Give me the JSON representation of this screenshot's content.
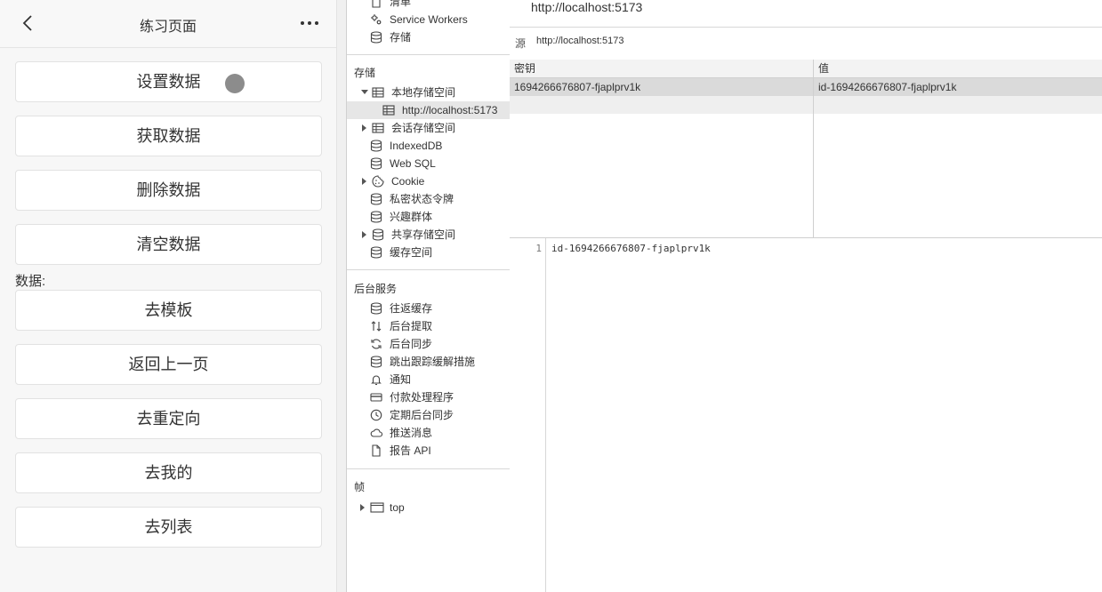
{
  "mobile": {
    "title": "练习页面",
    "buttons": [
      "设置数据",
      "获取数据",
      "删除数据",
      "清空数据"
    ],
    "data_label": "数据:",
    "nav_buttons": [
      "去模板",
      "返回上一页",
      "去重定向",
      "去我的",
      "去列表"
    ]
  },
  "sidebar": {
    "top_items": [
      {
        "label": "清单",
        "icon": "file-icon"
      },
      {
        "label": "Service Workers",
        "icon": "gears-icon"
      },
      {
        "label": "存储",
        "icon": "database-icon"
      }
    ],
    "storage_section": "存储",
    "storage_items": [
      {
        "label": "本地存储空间",
        "icon": "table-icon",
        "arrow": "down"
      },
      {
        "label": "http://localhost:5173",
        "icon": "table-icon",
        "arrow": "",
        "selected": true
      },
      {
        "label": "会话存储空间",
        "icon": "table-icon",
        "arrow": "right"
      },
      {
        "label": "IndexedDB",
        "icon": "database-icon",
        "arrow": ""
      },
      {
        "label": "Web SQL",
        "icon": "database-icon",
        "arrow": ""
      },
      {
        "label": "Cookie",
        "icon": "cookie-icon",
        "arrow": "right"
      },
      {
        "label": "私密状态令牌",
        "icon": "database-icon",
        "arrow": ""
      },
      {
        "label": "兴趣群体",
        "icon": "database-icon",
        "arrow": ""
      },
      {
        "label": "共享存储空间",
        "icon": "database-icon",
        "arrow": "right"
      },
      {
        "label": "缓存空间",
        "icon": "database-icon",
        "arrow": ""
      }
    ],
    "background_section": "后台服务",
    "background_items": [
      {
        "label": "往返缓存",
        "icon": "database-icon"
      },
      {
        "label": "后台提取",
        "icon": "arrows-updown-icon"
      },
      {
        "label": "后台同步",
        "icon": "sync-icon"
      },
      {
        "label": "跳出跟踪缓解措施",
        "icon": "database-icon"
      },
      {
        "label": "通知",
        "icon": "bell-icon"
      },
      {
        "label": "付款处理程序",
        "icon": "card-icon"
      },
      {
        "label": "定期后台同步",
        "icon": "clock-icon"
      },
      {
        "label": "推送消息",
        "icon": "cloud-icon"
      },
      {
        "label": "报告 API",
        "icon": "file-icon"
      }
    ],
    "frames_section": "帧",
    "frames_items": [
      {
        "label": "top",
        "icon": "window-icon",
        "arrow": "right"
      }
    ]
  },
  "main": {
    "origin_title": "http://localhost:5173",
    "origin_label": "源",
    "origin_value": "http://localhost:5173",
    "columns": [
      "密钥",
      "值"
    ],
    "rows": [
      {
        "key": "1694266676807-fjaplprv1k",
        "value": "id-1694266676807-fjaplprv1k"
      }
    ],
    "preview_line_number": "1",
    "preview_text": "id-1694266676807-fjaplprv1k"
  }
}
